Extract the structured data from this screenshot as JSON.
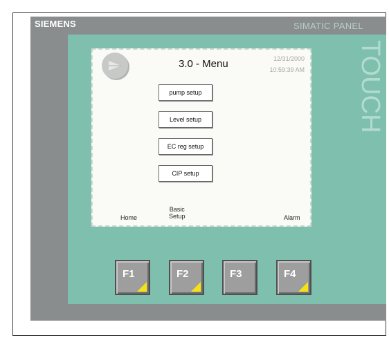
{
  "panel": {
    "brand": "SIEMENS",
    "model": "SIMATIC PANEL",
    "touch_label": "TOUCH"
  },
  "screen": {
    "title": "3.0 - Menu",
    "date": "12/31/2000",
    "time": "10:59:39 AM",
    "menu_buttons": [
      "pump setup",
      "Level setup",
      "EC reg setup",
      "CIP setup"
    ],
    "softkeys": {
      "home": "Home",
      "basic_setup_line1": "Basic",
      "basic_setup_line2": "Setup",
      "alarm": "Alarm"
    }
  },
  "function_keys": [
    "F1",
    "F2",
    "F3",
    "F4"
  ],
  "colors": {
    "bezel": "#7fbfae",
    "panel": "#8a8d8e",
    "key_corner": "#f4e215"
  }
}
